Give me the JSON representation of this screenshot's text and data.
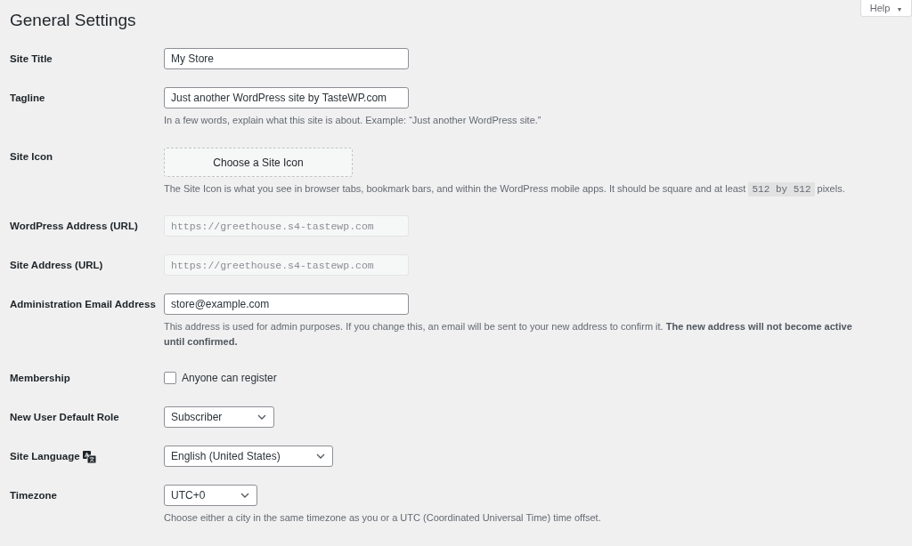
{
  "page": {
    "title": "General Settings"
  },
  "help_tab": {
    "label": "Help",
    "caret": "▼"
  },
  "settings": [
    {
      "kind": "text",
      "label": "Site Title",
      "value": "My Store"
    },
    {
      "kind": "text",
      "label": "Tagline",
      "value": "Just another WordPress site by TasteWP.com",
      "description": [
        {
          "kind": "text",
          "text": "In a few words, explain what this site is about. Example: “Just another WordPress site.”"
        }
      ]
    },
    {
      "kind": "button",
      "label": "Site Icon",
      "value": "Choose a Site Icon",
      "description": [
        {
          "kind": "text",
          "text": "The Site Icon is what you see in browser tabs, bookmark bars, and within the WordPress mobile apps. It should be square and at least "
        },
        {
          "kind": "code",
          "text": "512 by 512"
        },
        {
          "kind": "text",
          "text": " pixels."
        }
      ]
    },
    {
      "kind": "readonly",
      "label": "WordPress Address (URL)",
      "value": "https://greethouse.s4-tastewp.com"
    },
    {
      "kind": "readonly",
      "label": "Site Address (URL)",
      "value": "https://greethouse.s4-tastewp.com"
    },
    {
      "kind": "text",
      "label": "Administration Email Address",
      "value": "store@example.com",
      "description": [
        {
          "kind": "text",
          "text": "This address is used for admin purposes. If you change this, an email will be sent to your new address to confirm it. **The new address will not become active until confirmed.**"
        }
      ]
    },
    {
      "kind": "checkbox",
      "label": "Membership",
      "value": "Anyone can register",
      "checked": false
    },
    {
      "kind": "select",
      "label": "New User Default Role",
      "value": "Subscriber"
    },
    {
      "kind": "select",
      "label": "Site Language",
      "value": "English (United States)",
      "language_icon": true
    },
    {
      "kind": "select",
      "label": "Timezone",
      "value": "UTC+0",
      "description": [
        {
          "kind": "text",
          "text": "Choose either a city in the same timezone as you or a UTC (Coordinated Universal Time) time offset."
        }
      ]
    }
  ]
}
